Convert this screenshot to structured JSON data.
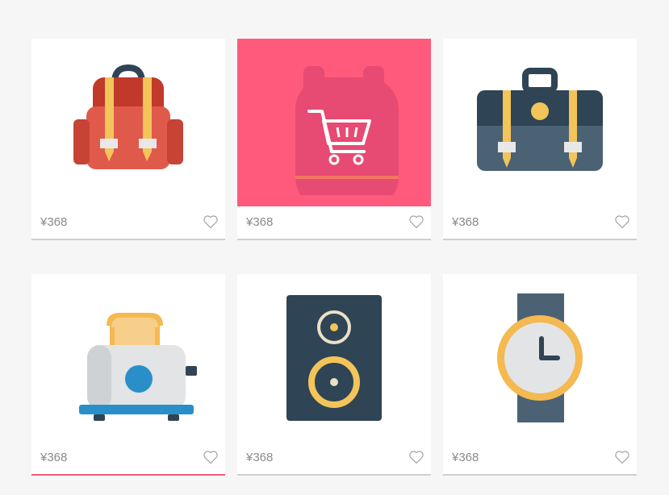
{
  "colors": {
    "background": "#f6f6f6",
    "card": "#ffffff",
    "price_text": "#8a8a8a",
    "divider": "#cfcfcf",
    "highlight": "#ff5a7c",
    "active_underline": "#ee5a7c"
  },
  "products": [
    {
      "name": "backpack",
      "icon": "backpack-icon",
      "price": "¥368",
      "favorite_icon": "heart-outline-icon"
    },
    {
      "name": "cart-bag",
      "icon": "shopping-cart-icon",
      "price": "¥368",
      "favorite_icon": "heart-outline-icon",
      "highlighted": true
    },
    {
      "name": "briefcase",
      "icon": "briefcase-icon",
      "price": "¥368",
      "favorite_icon": "heart-outline-icon"
    },
    {
      "name": "toaster",
      "icon": "toaster-icon",
      "price": "¥368",
      "favorite_icon": "heart-outline-icon",
      "active": true
    },
    {
      "name": "speaker",
      "icon": "speaker-icon",
      "price": "¥368",
      "favorite_icon": "heart-outline-icon"
    },
    {
      "name": "watch",
      "icon": "watch-icon",
      "price": "¥368",
      "favorite_icon": "heart-outline-icon"
    }
  ]
}
